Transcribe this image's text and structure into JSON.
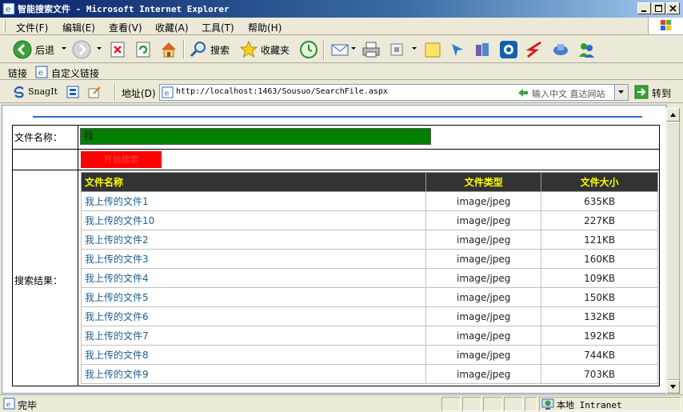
{
  "window": {
    "title": "智能搜索文件 - Microsoft Internet Explorer"
  },
  "menu": [
    "文件(F)",
    "编辑(E)",
    "查看(V)",
    "收藏(A)",
    "工具(T)",
    "帮助(H)"
  ],
  "toolbar": {
    "back_label": "后退",
    "search_label": "搜索",
    "favorites_label": "收藏夹"
  },
  "links": {
    "label": "链接",
    "custom_label": "自定义链接"
  },
  "addressbar": {
    "snagit_label": "SnagIt",
    "address_label": "地址(D)",
    "url": "http://localhost:1463/Sousuo/SearchFile.aspx",
    "hint": "输入中文 直达网站",
    "go_label": "转到"
  },
  "form": {
    "filename_label": "文件名称：",
    "search_value": "我",
    "search_button": "开始搜索",
    "results_label": "搜索结果："
  },
  "results": {
    "headers": [
      "文件名称",
      "文件类型",
      "文件大小"
    ],
    "rows": [
      {
        "name": "我上传的文件1",
        "type": "image/jpeg",
        "size": "635KB"
      },
      {
        "name": "我上传的文件10",
        "type": "image/jpeg",
        "size": "227KB"
      },
      {
        "name": "我上传的文件2",
        "type": "image/jpeg",
        "size": "121KB"
      },
      {
        "name": "我上传的文件3",
        "type": "image/jpeg",
        "size": "160KB"
      },
      {
        "name": "我上传的文件4",
        "type": "image/jpeg",
        "size": "109KB"
      },
      {
        "name": "我上传的文件5",
        "type": "image/jpeg",
        "size": "150KB"
      },
      {
        "name": "我上传的文件6",
        "type": "image/jpeg",
        "size": "132KB"
      },
      {
        "name": "我上传的文件7",
        "type": "image/jpeg",
        "size": "192KB"
      },
      {
        "name": "我上传的文件8",
        "type": "image/jpeg",
        "size": "744KB"
      },
      {
        "name": "我上传的文件9",
        "type": "image/jpeg",
        "size": "703KB"
      }
    ]
  },
  "status": {
    "text": "完毕",
    "zone": "本地 Intranet"
  },
  "colors": {
    "header_bg": "#333333",
    "header_text": "#ffff00",
    "input_bg": "#008000",
    "button_bg": "#ff0000",
    "link_text": "#1f5e8e",
    "rule": "#2a6cc8"
  }
}
